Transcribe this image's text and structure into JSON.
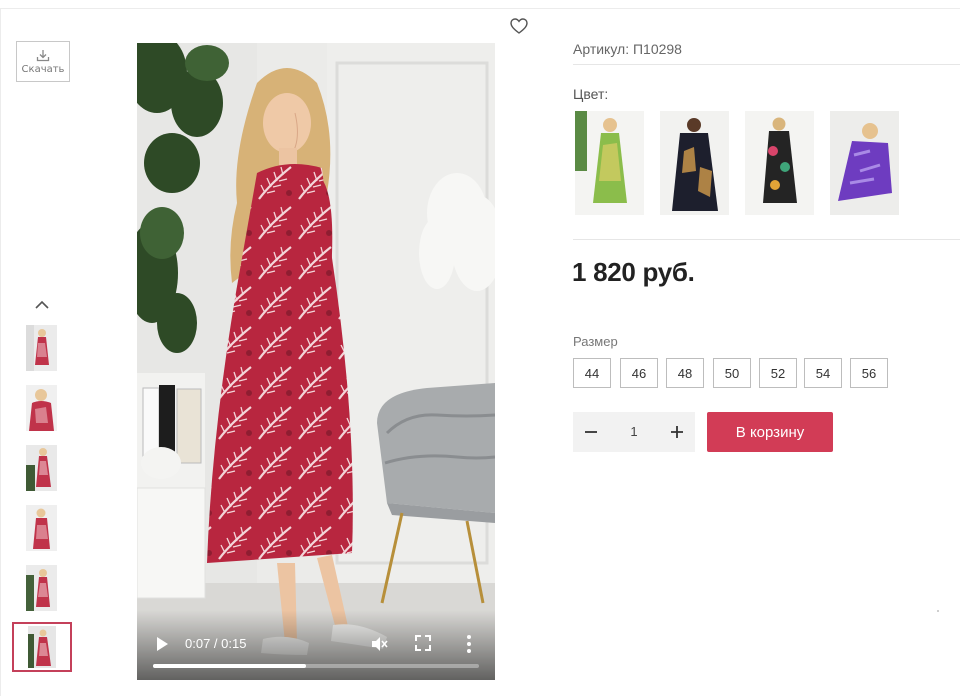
{
  "gallery": {
    "download_label": "Скачать",
    "thumbnails": [
      {
        "name": "thumb-1"
      },
      {
        "name": "thumb-2"
      },
      {
        "name": "thumb-3"
      },
      {
        "name": "thumb-4"
      },
      {
        "name": "thumb-5"
      },
      {
        "name": "thumb-video",
        "active": true
      }
    ]
  },
  "video": {
    "time": "0:07 / 0:15",
    "progress": 0.47
  },
  "product": {
    "article": "Артикул: П10298",
    "color_label": "Цвет:",
    "price": "1 820 руб.",
    "size_label": "Размер",
    "sizes": [
      "44",
      "46",
      "48",
      "50",
      "52",
      "54",
      "56"
    ],
    "quantity": "1",
    "cart_label": "В корзину"
  },
  "colors": {
    "accent": "#d23c56",
    "thumb_border": "#c4405a"
  },
  "icons": {
    "favorite": "heart-outline",
    "download": "download-tray",
    "up": "chevron-up",
    "play": "play",
    "volume": "volume-muted",
    "fullscreen": "fullscreen",
    "more": "vertical-dots",
    "minus": "minus",
    "plus": "plus"
  }
}
